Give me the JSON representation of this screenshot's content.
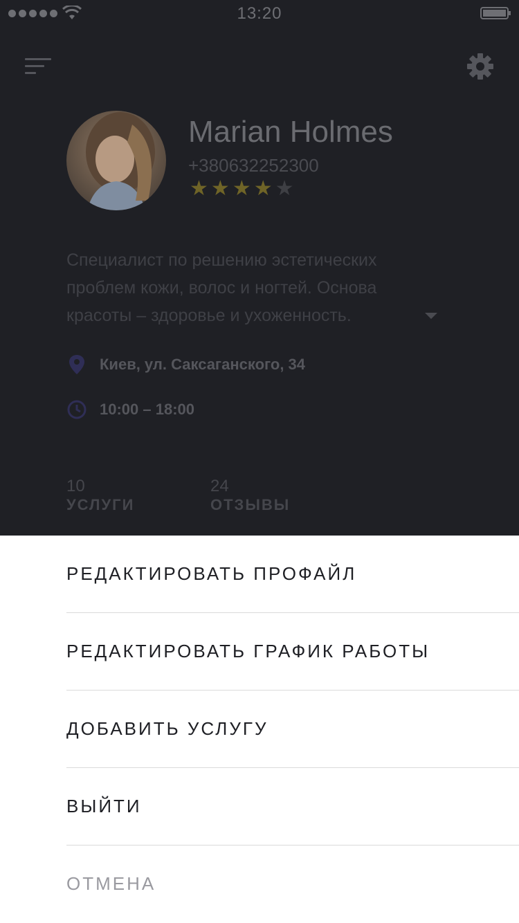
{
  "status_bar": {
    "time": "13:20"
  },
  "header": {
    "menu_icon": "menu-icon",
    "settings_icon": "gear-icon"
  },
  "profile": {
    "name": "Marian Holmes",
    "phone": "+380632252300",
    "rating": 4,
    "rating_max": 5,
    "star_symbol": "★",
    "bio": "Специалист по решению эстетических проблем кожи, волос и ногтей. Основа красоты – здоровье и ухоженность.",
    "address": "Киев, ул. Саксаганского, 34",
    "hours": "10:00 – 18:00",
    "stats": [
      {
        "value": "10",
        "label": "УСЛУГИ"
      },
      {
        "value": "24",
        "label": "ОТЗЫВЫ"
      }
    ]
  },
  "colors": {
    "accent": "#3a3870",
    "star": "#6f6427",
    "sheet_background": "#ffffff",
    "dim_background": "#1f2025"
  },
  "action_sheet": {
    "items": [
      {
        "label": "РЕДАКТИРОВАТЬ ПРОФАЙЛ"
      },
      {
        "label": "РЕДАКТИРОВАТЬ ГРАФИК РАБОТЫ"
      },
      {
        "label": "ДОБАВИТЬ УСЛУГУ"
      },
      {
        "label": "ВЫЙТИ"
      },
      {
        "label": "ОТМЕНА"
      }
    ]
  }
}
